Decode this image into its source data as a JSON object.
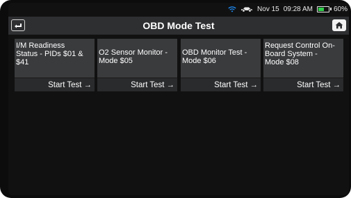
{
  "status_bar": {
    "date": "Nov 15",
    "time": "09:28 AM",
    "battery_percent": "60%",
    "battery_level": 0.6,
    "icons": [
      "wifi-icon",
      "car-icon",
      "battery-icon"
    ]
  },
  "header": {
    "title": "OBD Mode Test",
    "back_icon": "back-arrow-icon",
    "home_icon": "home-icon"
  },
  "tiles": [
    {
      "label": "I/M Readiness\nStatus - PIDs $01 &\n$41",
      "action": "Start Test"
    },
    {
      "label": "O2 Sensor Monitor -\nMode $05",
      "action": "Start Test"
    },
    {
      "label": "OBD Monitor Test -\nMode $06",
      "action": "Start Test"
    },
    {
      "label": "Request Control On-\nBoard System -\nMode $08",
      "action": "Start Test"
    }
  ],
  "colors": {
    "background": "#111111",
    "title_bar": "#2e2f31",
    "tile": "#3a3b3d",
    "battery_fill": "#30d04c",
    "wifi": "#1e90ff"
  }
}
